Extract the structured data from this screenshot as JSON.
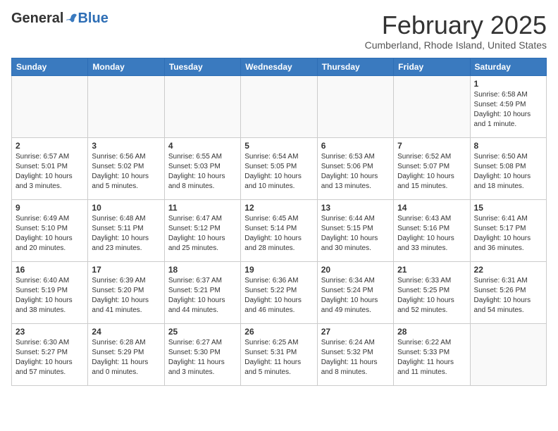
{
  "logo": {
    "general": "General",
    "blue": "Blue"
  },
  "header": {
    "month_year": "February 2025",
    "location": "Cumberland, Rhode Island, United States"
  },
  "days_of_week": [
    "Sunday",
    "Monday",
    "Tuesday",
    "Wednesday",
    "Thursday",
    "Friday",
    "Saturday"
  ],
  "weeks": [
    [
      {
        "day": "",
        "info": ""
      },
      {
        "day": "",
        "info": ""
      },
      {
        "day": "",
        "info": ""
      },
      {
        "day": "",
        "info": ""
      },
      {
        "day": "",
        "info": ""
      },
      {
        "day": "",
        "info": ""
      },
      {
        "day": "1",
        "info": "Sunrise: 6:58 AM\nSunset: 4:59 PM\nDaylight: 10 hours and 1 minute."
      }
    ],
    [
      {
        "day": "2",
        "info": "Sunrise: 6:57 AM\nSunset: 5:01 PM\nDaylight: 10 hours and 3 minutes."
      },
      {
        "day": "3",
        "info": "Sunrise: 6:56 AM\nSunset: 5:02 PM\nDaylight: 10 hours and 5 minutes."
      },
      {
        "day": "4",
        "info": "Sunrise: 6:55 AM\nSunset: 5:03 PM\nDaylight: 10 hours and 8 minutes."
      },
      {
        "day": "5",
        "info": "Sunrise: 6:54 AM\nSunset: 5:05 PM\nDaylight: 10 hours and 10 minutes."
      },
      {
        "day": "6",
        "info": "Sunrise: 6:53 AM\nSunset: 5:06 PM\nDaylight: 10 hours and 13 minutes."
      },
      {
        "day": "7",
        "info": "Sunrise: 6:52 AM\nSunset: 5:07 PM\nDaylight: 10 hours and 15 minutes."
      },
      {
        "day": "8",
        "info": "Sunrise: 6:50 AM\nSunset: 5:08 PM\nDaylight: 10 hours and 18 minutes."
      }
    ],
    [
      {
        "day": "9",
        "info": "Sunrise: 6:49 AM\nSunset: 5:10 PM\nDaylight: 10 hours and 20 minutes."
      },
      {
        "day": "10",
        "info": "Sunrise: 6:48 AM\nSunset: 5:11 PM\nDaylight: 10 hours and 23 minutes."
      },
      {
        "day": "11",
        "info": "Sunrise: 6:47 AM\nSunset: 5:12 PM\nDaylight: 10 hours and 25 minutes."
      },
      {
        "day": "12",
        "info": "Sunrise: 6:45 AM\nSunset: 5:14 PM\nDaylight: 10 hours and 28 minutes."
      },
      {
        "day": "13",
        "info": "Sunrise: 6:44 AM\nSunset: 5:15 PM\nDaylight: 10 hours and 30 minutes."
      },
      {
        "day": "14",
        "info": "Sunrise: 6:43 AM\nSunset: 5:16 PM\nDaylight: 10 hours and 33 minutes."
      },
      {
        "day": "15",
        "info": "Sunrise: 6:41 AM\nSunset: 5:17 PM\nDaylight: 10 hours and 36 minutes."
      }
    ],
    [
      {
        "day": "16",
        "info": "Sunrise: 6:40 AM\nSunset: 5:19 PM\nDaylight: 10 hours and 38 minutes."
      },
      {
        "day": "17",
        "info": "Sunrise: 6:39 AM\nSunset: 5:20 PM\nDaylight: 10 hours and 41 minutes."
      },
      {
        "day": "18",
        "info": "Sunrise: 6:37 AM\nSunset: 5:21 PM\nDaylight: 10 hours and 44 minutes."
      },
      {
        "day": "19",
        "info": "Sunrise: 6:36 AM\nSunset: 5:22 PM\nDaylight: 10 hours and 46 minutes."
      },
      {
        "day": "20",
        "info": "Sunrise: 6:34 AM\nSunset: 5:24 PM\nDaylight: 10 hours and 49 minutes."
      },
      {
        "day": "21",
        "info": "Sunrise: 6:33 AM\nSunset: 5:25 PM\nDaylight: 10 hours and 52 minutes."
      },
      {
        "day": "22",
        "info": "Sunrise: 6:31 AM\nSunset: 5:26 PM\nDaylight: 10 hours and 54 minutes."
      }
    ],
    [
      {
        "day": "23",
        "info": "Sunrise: 6:30 AM\nSunset: 5:27 PM\nDaylight: 10 hours and 57 minutes."
      },
      {
        "day": "24",
        "info": "Sunrise: 6:28 AM\nSunset: 5:29 PM\nDaylight: 11 hours and 0 minutes."
      },
      {
        "day": "25",
        "info": "Sunrise: 6:27 AM\nSunset: 5:30 PM\nDaylight: 11 hours and 3 minutes."
      },
      {
        "day": "26",
        "info": "Sunrise: 6:25 AM\nSunset: 5:31 PM\nDaylight: 11 hours and 5 minutes."
      },
      {
        "day": "27",
        "info": "Sunrise: 6:24 AM\nSunset: 5:32 PM\nDaylight: 11 hours and 8 minutes."
      },
      {
        "day": "28",
        "info": "Sunrise: 6:22 AM\nSunset: 5:33 PM\nDaylight: 11 hours and 11 minutes."
      },
      {
        "day": "",
        "info": ""
      }
    ]
  ]
}
